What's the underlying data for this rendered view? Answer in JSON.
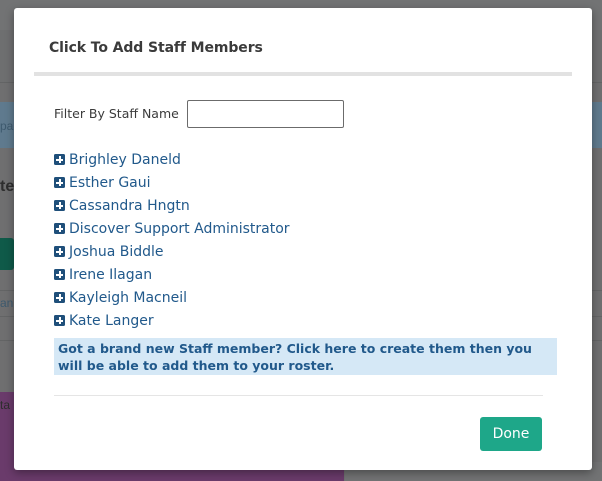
{
  "background": {
    "text_fragments": [
      "pa",
      "te",
      "an",
      "ta",
      "Cont"
    ]
  },
  "modal": {
    "title": "Click To Add Staff Members",
    "filter": {
      "label": "Filter By Staff Name",
      "value": "",
      "placeholder": ""
    },
    "staff": [
      {
        "name": "Brighley Daneld"
      },
      {
        "name": "Esther Gaui"
      },
      {
        "name": "Cassandra Hngtn"
      },
      {
        "name": "Discover Support Administrator"
      },
      {
        "name": "Joshua Biddle"
      },
      {
        "name": "Irene Ilagan"
      },
      {
        "name": "Kayleigh Macneil"
      },
      {
        "name": "Kate Langer"
      }
    ],
    "create_banner": "Got a brand new Staff member? Click here to create them then you will be able to add them to your roster.",
    "done_label": "Done"
  },
  "colors": {
    "accent_button": "#1ea789",
    "link": "#21598b",
    "banner_bg": "#d5e8f6"
  },
  "icons": {
    "staff_item": "plus-square-icon"
  }
}
